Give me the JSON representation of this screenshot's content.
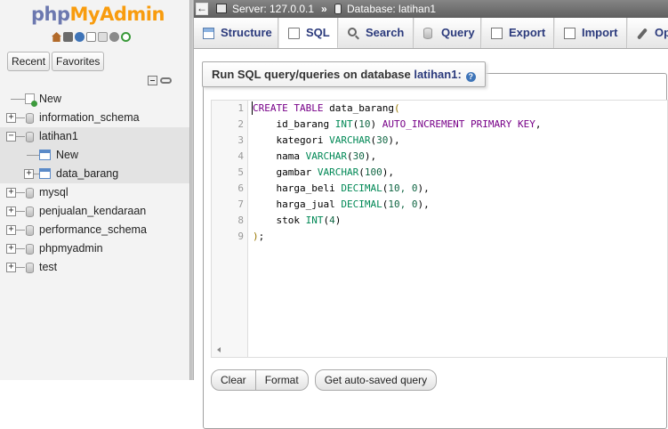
{
  "nav": {
    "logo_php": "php",
    "logo_myadmin": "MyAdmin",
    "icons": [
      "home-icon",
      "logout-icon",
      "help-icon",
      "docs-icon",
      "copy-icon",
      "settings-icon",
      "reload-icon"
    ],
    "tabs": [
      "Recent",
      "Favorites"
    ],
    "tree": {
      "new": "New",
      "information_schema": "information_schema",
      "latihan1": "latihan1",
      "latihan1_new": "New",
      "data_barang": "data_barang",
      "mysql": "mysql",
      "penjualan_kendaraan": "penjualan_kendaraan",
      "performance_schema": "performance_schema",
      "phpmyadmin": "phpmyadmin",
      "test": "test"
    }
  },
  "breadcrumb": {
    "toggle": "←",
    "server": "Server: 127.0.0.1",
    "separator": "»",
    "database": "Database: latihan1"
  },
  "tabs": {
    "structure": "Structure",
    "sql": "SQL",
    "search": "Search",
    "query": "Query",
    "export": "Export",
    "import": "Import",
    "operations": "Op"
  },
  "sql_box": {
    "legend": "Run SQL query/queries on database ",
    "database": "latihan1:",
    "help": "?",
    "line_numbers": [
      "1",
      "2",
      "3",
      "4",
      "5",
      "6",
      "7",
      "8",
      "9"
    ],
    "code": {
      "l1_kw": "CREATE TABLE",
      "l1_rest": " data_barang",
      "l1_br": "(",
      "l2_id": "    id_barang ",
      "l2_type": "INT",
      "l2_br1": "(",
      "l2_num": "10",
      "l2_br2": ")",
      "l2_kw": " AUTO_INCREMENT PRIMARY KEY",
      "l2_end": ",",
      "l3_id": "    kategori ",
      "l3_type": "VARCHAR",
      "l3_br1": "(",
      "l3_num": "30",
      "l3_br2": ")",
      "l3_end": ",",
      "l4_id": "    nama ",
      "l4_type": "VARCHAR",
      "l4_br1": "(",
      "l4_num": "30",
      "l4_br2": ")",
      "l4_end": ",",
      "l5_id": "    gambar ",
      "l5_type": "VARCHAR",
      "l5_br1": "(",
      "l5_num": "100",
      "l5_br2": ")",
      "l5_end": ",",
      "l6_id": "    harga_beli ",
      "l6_type": "DECIMAL",
      "l6_br1": "(",
      "l6_num": "10, 0",
      "l6_br2": ")",
      "l6_end": ",",
      "l7_id": "    harga_jual ",
      "l7_type": "DECIMAL",
      "l7_br1": "(",
      "l7_num": "10, 0",
      "l7_br2": ")",
      "l7_end": ",",
      "l8_id": "    stok ",
      "l8_type": "INT",
      "l8_br1": "(",
      "l8_num": "4",
      "l8_br2": ")",
      "l9_br": ")",
      "l9_end": ";"
    }
  },
  "buttons": {
    "clear": "Clear",
    "format": "Format",
    "autosave": "Get auto-saved query"
  },
  "colors": {
    "logo_php": "#6c78af",
    "logo_myadmin": "#f89c0e",
    "tab_text": "#2b3a7c",
    "sql_keyword": "#770088",
    "sql_type": "#008855"
  }
}
